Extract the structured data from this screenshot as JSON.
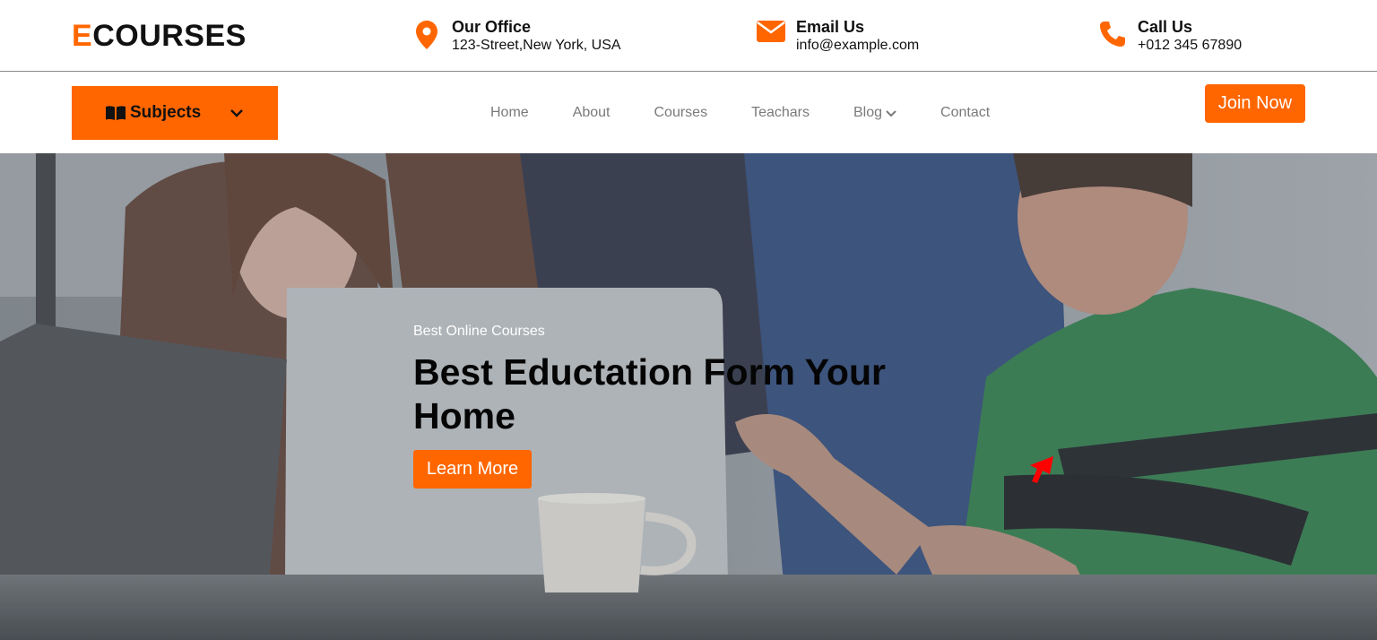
{
  "brand": {
    "logo_first": "E",
    "logo_rest": "COURSES",
    "accent": "#ff6600"
  },
  "contacts": {
    "office": {
      "title": "Our Office",
      "value": "123-Street,New York, USA",
      "icon": "map-pin-icon"
    },
    "email": {
      "title": "Email Us",
      "value": "info@example.com",
      "icon": "envelope-icon"
    },
    "phone": {
      "title": "Call Us",
      "value": "+012 345 67890",
      "icon": "phone-icon"
    }
  },
  "nav": {
    "subjects_label": "Subjects",
    "links": [
      "Home",
      "About",
      "Courses",
      "Teachars",
      "Blog",
      "Contact"
    ],
    "join_label": "Join Now"
  },
  "hero": {
    "kicker": "Best Online Courses",
    "title": "Best Eductation Form Your Home",
    "button_label": "Learn More"
  }
}
